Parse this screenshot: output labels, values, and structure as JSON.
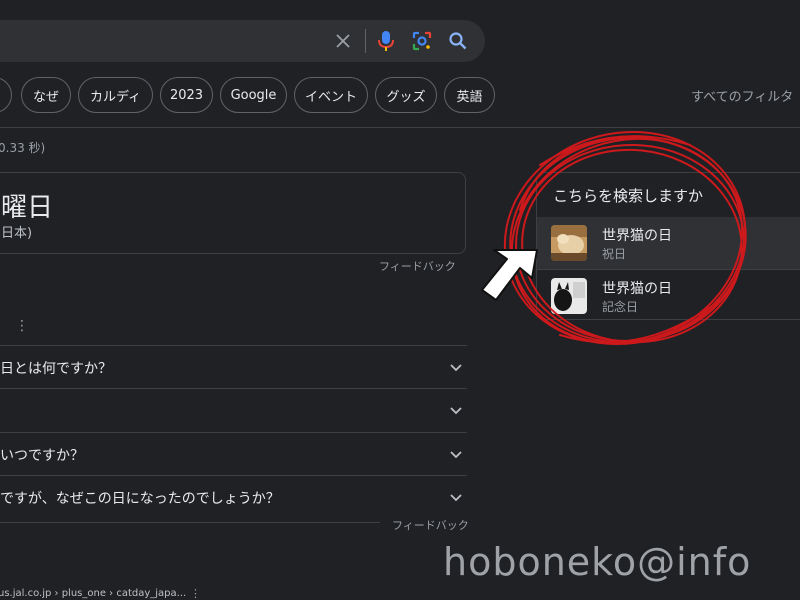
{
  "search": {
    "clear_icon": "close-icon",
    "voice_icon": "mic-icon",
    "lens_icon": "lens-icon",
    "search_icon": "search-icon"
  },
  "chips": [
    "ず",
    "なぜ",
    "カルディ",
    "2023",
    "Google",
    "イベント",
    "グッズ",
    "英語"
  ],
  "all_filters": "すべてのフィルタ",
  "stats": "0.33 秒)",
  "answer": {
    "big": "曜日",
    "sub": "日本)",
    "feedback": "フィードバック"
  },
  "faq": {
    "questions": [
      "日とは何ですか？",
      "",
      "いつですか？",
      "ですが、なぜこの日になったのでしょうか？"
    ],
    "feedback": "フィードバック"
  },
  "result_url": "us.jal.co.jp › plus_one › catday_japa...",
  "suggest": {
    "title": "こちらを検索しますか",
    "items": [
      {
        "name": "世界猫の日",
        "sub": "祝日"
      },
      {
        "name": "世界猫の日",
        "sub": "記念日"
      }
    ]
  },
  "watermark": "hoboneko@info",
  "colors": {
    "background": "#202124",
    "surface": "#303134",
    "border": "#3c4043",
    "annotation": "#d7191c"
  }
}
